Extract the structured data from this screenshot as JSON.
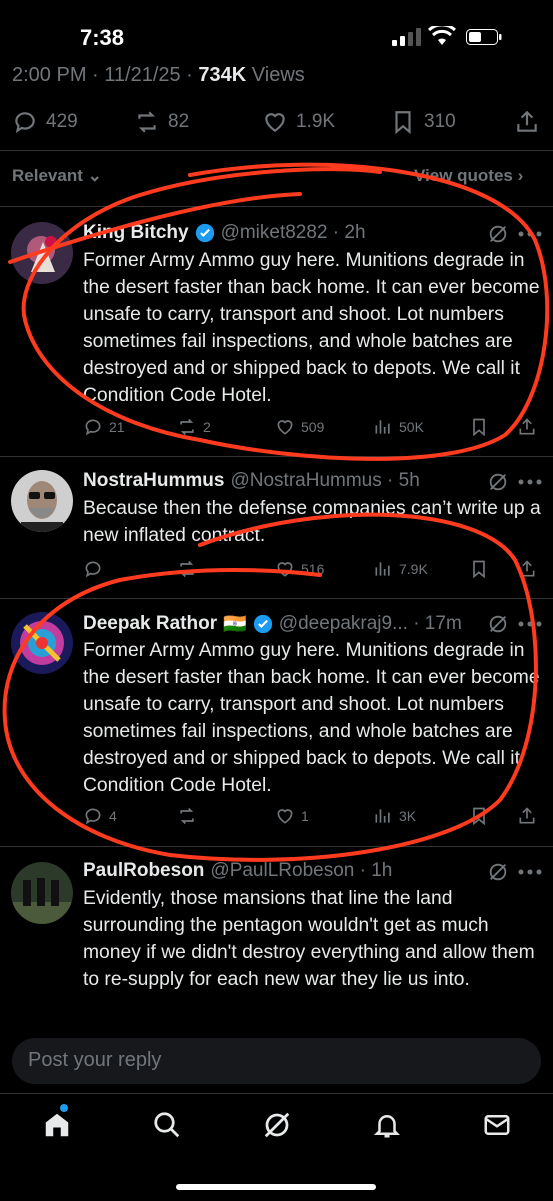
{
  "status_bar": {
    "time": "7:38"
  },
  "post_meta": {
    "time": "2:00 PM · 11/21/25 · ",
    "views_count": "734K",
    "views_label": " Views"
  },
  "engagement": {
    "replies": "429",
    "reposts": "82",
    "likes": "1.9K",
    "bookmarks": "310"
  },
  "sort": {
    "relevant": "Relevant",
    "view_quotes": "View quotes"
  },
  "tweets": [
    {
      "name": "King Bitchy",
      "handle": "@miket8282 · 2h",
      "verified": true,
      "text": "Former Army Ammo guy here. Munitions degrade in the desert faster than back home. It can ever become unsafe to carry, transport and shoot. Lot numbers sometimes fail inspections, and whole batches are destroyed and or shipped back to depots. We call it Condition Code Hotel.",
      "replies": "21",
      "reposts": "2",
      "likes": "509",
      "views": "50K"
    },
    {
      "name": "NostraHummus",
      "handle": "@NostraHummus · 5h",
      "verified": false,
      "text": "Because then the defense companies can’t write up a new inflated contract.",
      "replies": "",
      "reposts": "",
      "likes": "516",
      "views": "7.9K"
    },
    {
      "name": "Deepak Rathor",
      "flag": "🇮🇳",
      "handle": "@deepakraj9... · 17m",
      "verified": true,
      "text": "Former Army Ammo guy here. Munitions degrade in the desert faster than back home. It can ever become unsafe to carry, transport and shoot. Lot numbers sometimes fail inspections, and whole batches are destroyed and or shipped back to depots. We call it Condition Code Hotel.",
      "replies": "4",
      "reposts": "",
      "likes": "1",
      "views": "3K"
    },
    {
      "name": "PaulRobeson",
      "handle": "@PaulLRobeson · 1h",
      "verified": false,
      "text": "Evidently, those mansions that line the land surrounding the pentagon wouldn't get as much money if we didn't destroy everything and allow them to re-supply for each new war they lie us into."
    }
  ],
  "reply": {
    "placeholder": "Post your reply"
  },
  "nav": [
    "home-icon",
    "search-icon",
    "grok-icon",
    "notifications-icon",
    "messages-icon"
  ],
  "colors": {
    "accent": "#1d9bf0",
    "annotation": "#ff3b1f",
    "muted": "#71767b"
  }
}
